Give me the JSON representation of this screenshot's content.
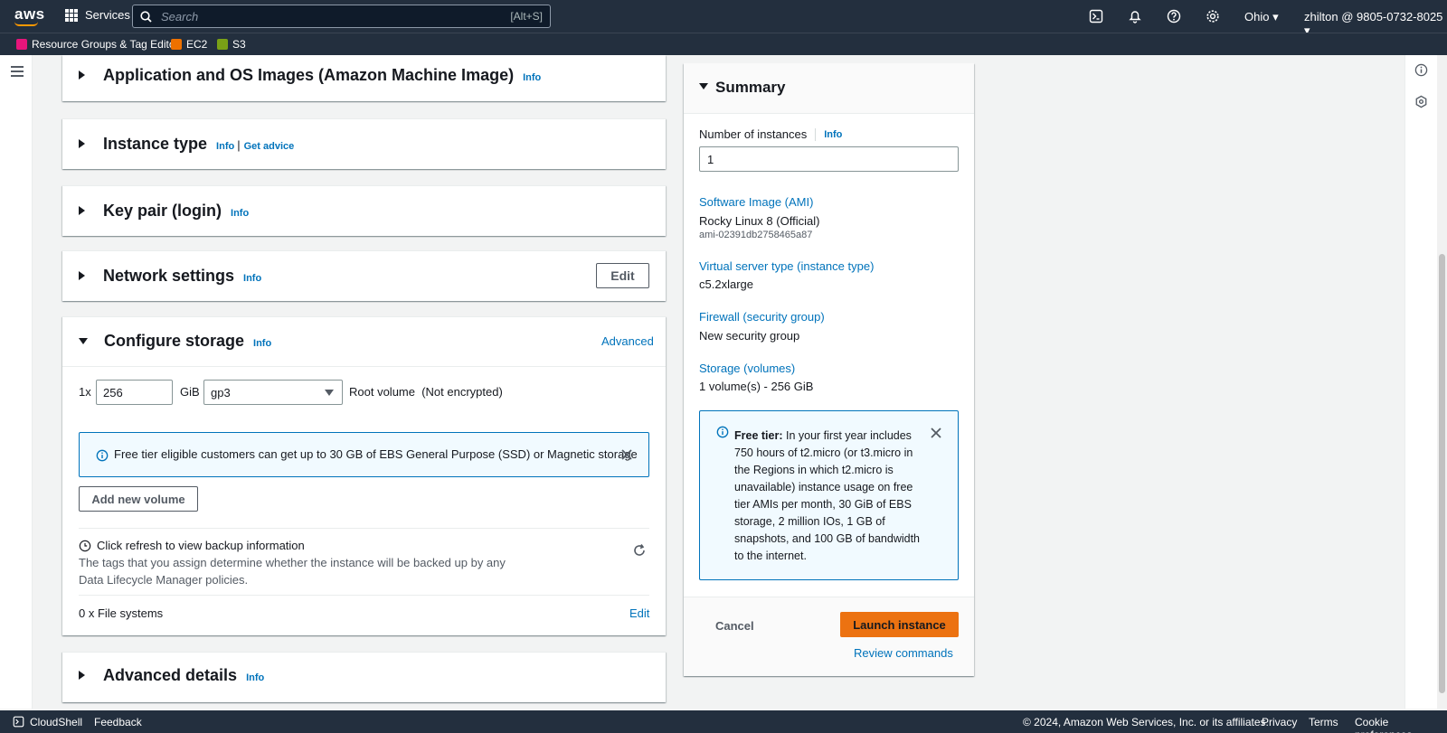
{
  "topnav": {
    "logo": "aws",
    "services_label": "Services",
    "search_placeholder": "Search",
    "search_shortcut": "[Alt+S]",
    "region": "Ohio ▾",
    "account": "zhilton @ 9805-0732-8025 ▾"
  },
  "favorites": [
    {
      "label": "Resource Groups & Tag Editor",
      "color": "#e7157b"
    },
    {
      "label": "EC2",
      "color": "#ed7100"
    },
    {
      "label": "S3",
      "color": "#7aa116"
    }
  ],
  "sections": {
    "ami": {
      "title": "Application and OS Images (Amazon Machine Image)",
      "info": "Info"
    },
    "instance_type": {
      "title": "Instance type",
      "info": "Info",
      "sep": "|",
      "advice": "Get advice"
    },
    "key_pair": {
      "title": "Key pair (login)",
      "info": "Info"
    },
    "network": {
      "title": "Network settings",
      "info": "Info",
      "edit": "Edit"
    },
    "storage": {
      "title": "Configure storage",
      "info": "Info",
      "advanced": "Advanced",
      "multiplier": "1x",
      "size": "256",
      "unit": "GiB",
      "volume_type": "gp3",
      "root_label": "Root volume",
      "encryption": "(Not encrypted)",
      "free_tier_notice": "Free tier eligible customers can get up to 30 GB of EBS General Purpose (SSD) or Magnetic storage",
      "add_volume": "Add new volume",
      "backup_title": "Click refresh to view backup information",
      "backup_desc_1": "The tags that you assign determine whether the instance will be backed up by any",
      "backup_desc_2": "Data Lifecycle Manager policies.",
      "file_systems": "0 x File systems",
      "fs_edit": "Edit"
    },
    "advanced": {
      "title": "Advanced details",
      "info": "Info"
    }
  },
  "summary": {
    "title": "Summary",
    "num_instances_label": "Number of instances",
    "num_instances_info": "Info",
    "num_instances_value": "1",
    "ami_label": "Software Image (AMI)",
    "ami_value": "Rocky Linux 8 (Official)",
    "ami_id": "ami-02391db2758465a87",
    "type_label": "Virtual server type (instance type)",
    "type_value": "c5.2xlarge",
    "firewall_label": "Firewall (security group)",
    "firewall_value": "New security group",
    "storage_label": "Storage (volumes)",
    "storage_value": "1 volume(s) - 256 GiB",
    "free_tier_bold": "Free tier:",
    "free_tier_lines": [
      "In your first year includes",
      "750 hours of t2.micro (or t3.micro in",
      "the Regions in which t2.micro is",
      "unavailable) instance usage on free",
      "tier AMIs per month, 30 GiB of EBS",
      "storage, 2 million IOs, 1 GB of",
      "snapshots, and 100 GB of bandwidth",
      "to the internet."
    ],
    "cancel": "Cancel",
    "launch": "Launch instance",
    "review": "Review commands"
  },
  "footer": {
    "cloudshell": "CloudShell",
    "feedback": "Feedback",
    "copyright": "© 2024, Amazon Web Services, Inc. or its affiliates.",
    "privacy": "Privacy",
    "terms": "Terms",
    "cookies": "Cookie preferences"
  },
  "colors": {
    "accent": "#0073bb",
    "primary_button": "#ec7211",
    "nav": "#232f3e"
  }
}
